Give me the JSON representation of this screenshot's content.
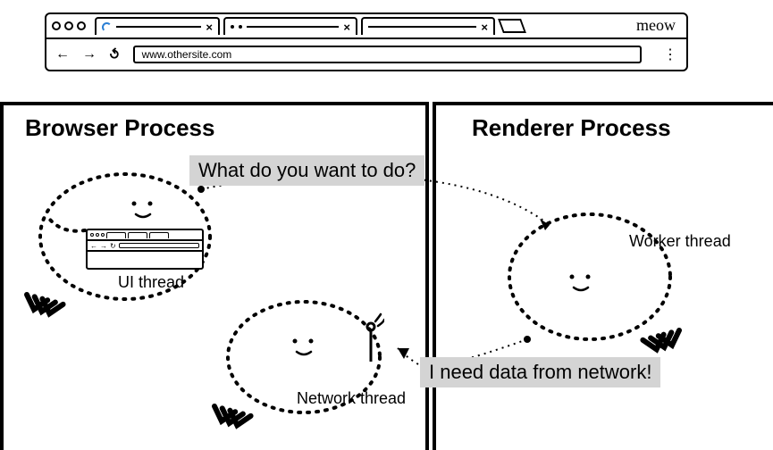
{
  "browser": {
    "brand": "meow",
    "url": "www.othersite.com"
  },
  "panels": {
    "left_title": "Browser Process",
    "right_title": "Renderer Process"
  },
  "speech": {
    "question": "What do you want to do?",
    "answer": "I need data from network!"
  },
  "threads": {
    "ui": "UI thread",
    "network": "Network thread",
    "worker": "Worker thread"
  }
}
